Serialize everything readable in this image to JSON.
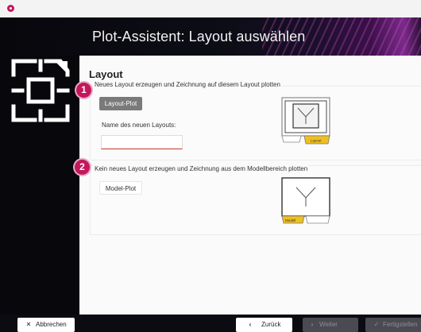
{
  "window": {
    "title": ""
  },
  "header": {
    "title": "Plot-Assistent: Layout auswählen"
  },
  "section": {
    "title": "Layout"
  },
  "option1": {
    "number": "1",
    "legend": "Neues Layout erzeugen und Zeichnung auf diesem Layout plotten",
    "button_label": "Layout-Plot",
    "name_label": "Name des neuen Layouts:",
    "name_value": "",
    "preview_tab": "Layout"
  },
  "option2": {
    "number": "2",
    "legend": "Kein neues Layout erzeugen und Zeichnung aus dem Modellbereich plotten",
    "button_label": "Model-Plot",
    "preview_tab": "Modell"
  },
  "footer": {
    "cancel_label": "Abbrechen",
    "back_label": "Zurück",
    "next_label": "Weiter",
    "finish_label": "Fertigstellen"
  },
  "colors": {
    "accent": "#c2185b",
    "tab_highlight": "#f0c020",
    "button_disabled": "#4a4a52"
  },
  "icons": {
    "app": "app-logo-icon",
    "sidebar": "layout-frame-icon",
    "cancel": "close-icon",
    "back": "chevron-left-icon",
    "next": "chevron-right-icon",
    "finish": "checkmark-icon"
  }
}
